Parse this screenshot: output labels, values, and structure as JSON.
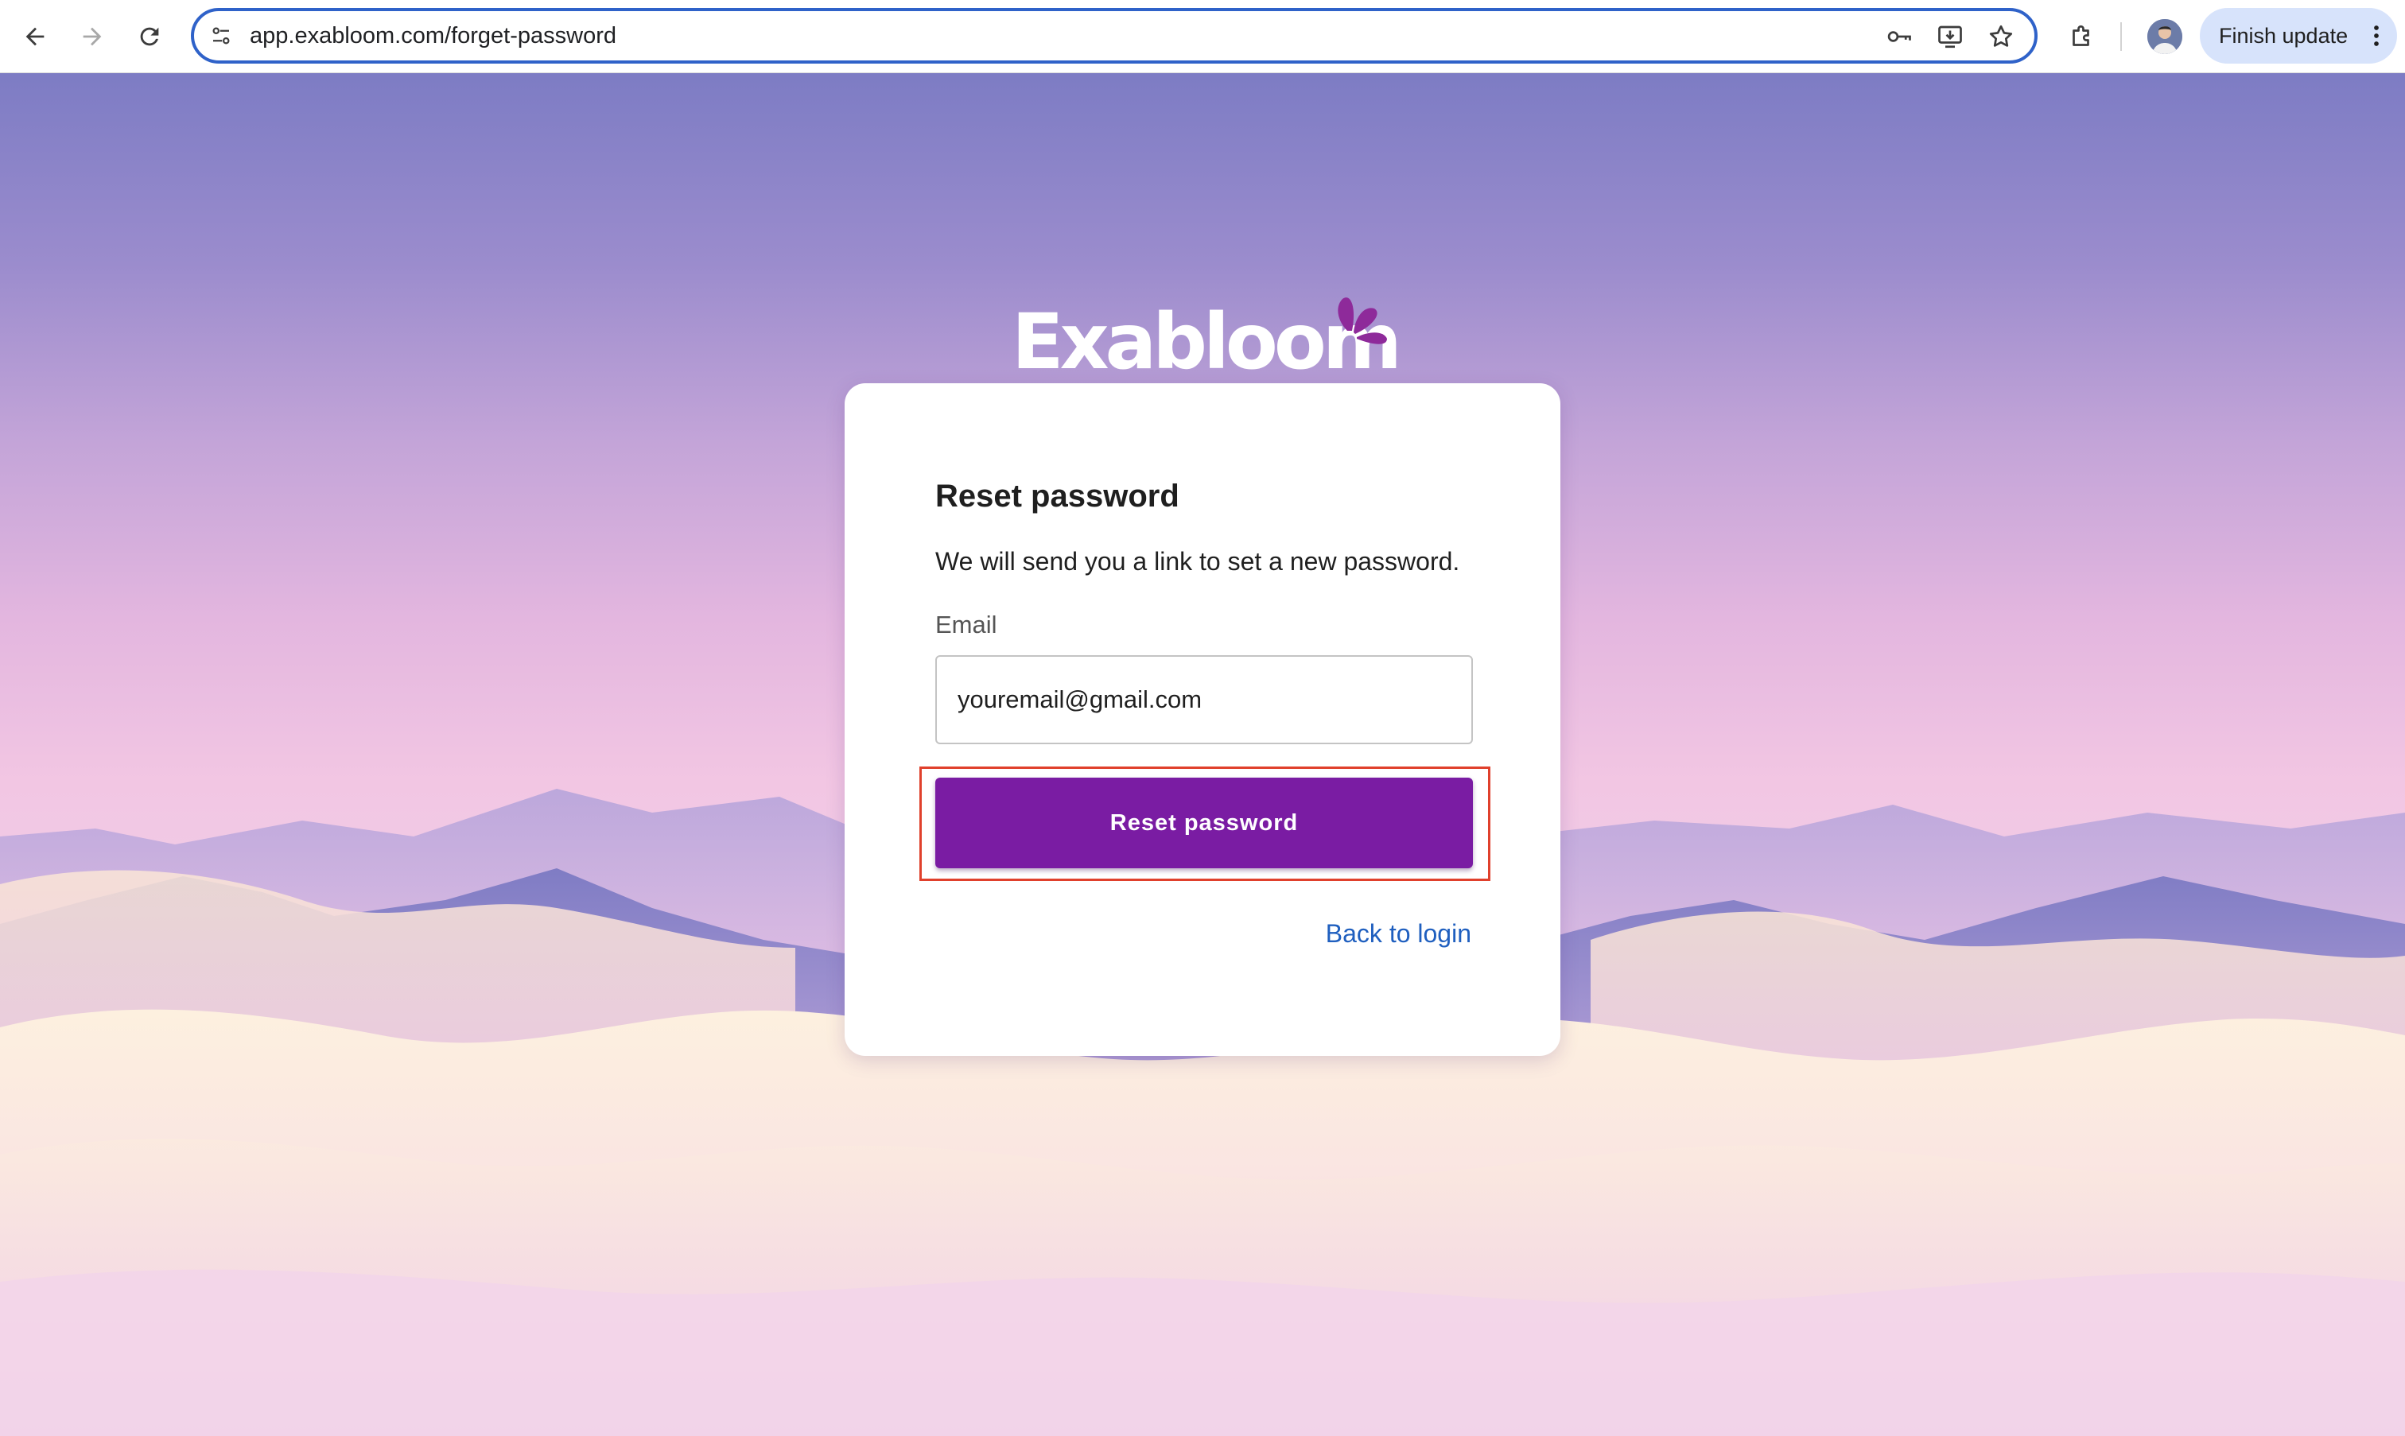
{
  "browser": {
    "url": "app.exabloom.com/forget-password",
    "finish_update_label": "Finish update",
    "toolbar_icons": [
      "back-arrow-icon",
      "forward-arrow-icon",
      "reload-icon",
      "site-settings-icon",
      "password-key-icon",
      "install-app-icon",
      "bookmark-star-icon",
      "extensions-puzzle-icon",
      "profile-avatar",
      "more-vert-icon"
    ]
  },
  "logo": {
    "text": "Exabloom",
    "petal_color": "#8e2a9a"
  },
  "card": {
    "title": "Reset password",
    "description": "We will send you a link to set a new password.",
    "email_label": "Email",
    "email_value": "youremail@gmail.com",
    "submit_label": "Reset password",
    "back_link_label": "Back to login"
  },
  "colors": {
    "button": "#7a1ca3",
    "link": "#1f5fbf",
    "highlight": "#e0402c",
    "omnibox_border": "#2f62c9",
    "update_pill": "#d7e3fb"
  }
}
